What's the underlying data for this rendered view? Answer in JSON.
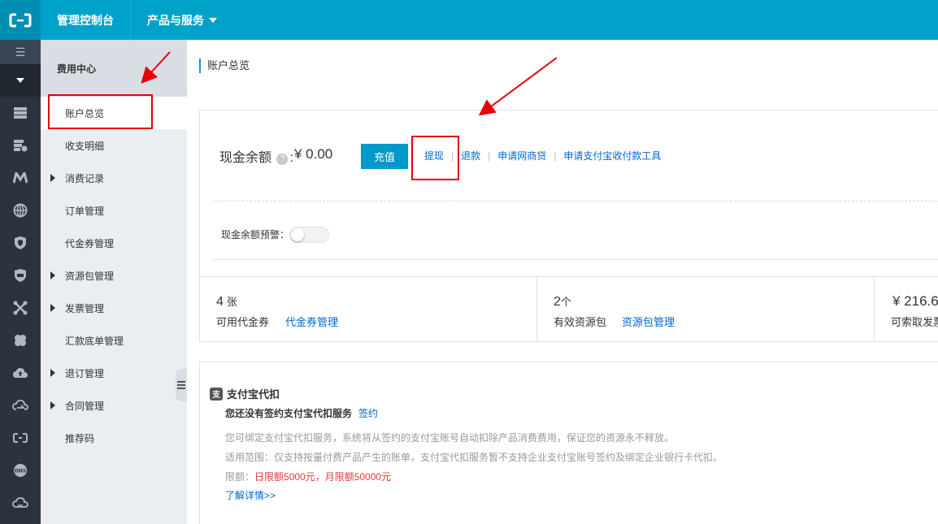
{
  "topbar": {
    "title": "管理控制台",
    "products_menu": "产品与服务",
    "bg_color": "#00a2ca"
  },
  "rail": {
    "toggle_icon": "hamburger-icon",
    "collapse_icon": "caret-down-icon",
    "icons": [
      "server-icon",
      "database-icon",
      "m-logo-icon",
      "globe-icon",
      "shield-icon",
      "badge-shield-icon",
      "network-icon",
      "flower-icon",
      "cloud-upload-icon",
      "cloud-arrow-icon",
      "bracket-logo-icon",
      "dns-icon",
      "cloud-icon"
    ]
  },
  "sidebar": {
    "header": "费用中心",
    "items": [
      {
        "label": "账户总览",
        "active": true,
        "expandable": false
      },
      {
        "label": "收支明细",
        "active": false,
        "expandable": false
      },
      {
        "label": "消费记录",
        "active": false,
        "expandable": true
      },
      {
        "label": "订单管理",
        "active": false,
        "expandable": false
      },
      {
        "label": "代金券管理",
        "active": false,
        "expandable": false
      },
      {
        "label": "资源包管理",
        "active": false,
        "expandable": true
      },
      {
        "label": "发票管理",
        "active": false,
        "expandable": true
      },
      {
        "label": "汇款底单管理",
        "active": false,
        "expandable": false
      },
      {
        "label": "退订管理",
        "active": false,
        "expandable": true
      },
      {
        "label": "合同管理",
        "active": false,
        "expandable": true
      },
      {
        "label": "推荐码",
        "active": false,
        "expandable": false
      }
    ]
  },
  "main": {
    "breadcrumb": "账户总览",
    "balance": {
      "label": "现金余额",
      "help_icon": "question-icon",
      "colon": ":",
      "amount": "¥ 0.00",
      "recharge_button": "充值",
      "links": [
        "提现",
        "退款",
        "申请网商贷",
        "申请支付宝收付款工具"
      ],
      "alert_label": "现金余额预警：",
      "alert_enabled": false
    },
    "stats": [
      {
        "number": "4",
        "unit": "张",
        "label": "可用代金券",
        "link": "代金券管理"
      },
      {
        "number": "2",
        "unit": "个",
        "label": "有效资源包",
        "link": "资源包管理"
      },
      {
        "number": "¥ 216.6",
        "unit": "",
        "label": "可索取发票",
        "link": ""
      }
    ],
    "alipay": {
      "icon": "alipay-icon",
      "title": "支付宝代扣",
      "not_signed_text": "您还没有签约支付宝代扣服务",
      "sign_link": "签约",
      "desc1": "您可绑定支付宝代扣服务，系统将从签约的支付宝账号自动扣除产品消费费用，保证您的资源永不释放。",
      "desc2": "适用范围：仅支持按量付费产品产生的账单，支付宝代扣服务暂不支持企业支付宝账号签约及绑定企业银行卡代扣。",
      "limit_label": "限额：",
      "limit_value": "日限额5000元，月限额50000元",
      "more_link": "了解详情>>"
    }
  },
  "annotation_color": "#e8000b"
}
